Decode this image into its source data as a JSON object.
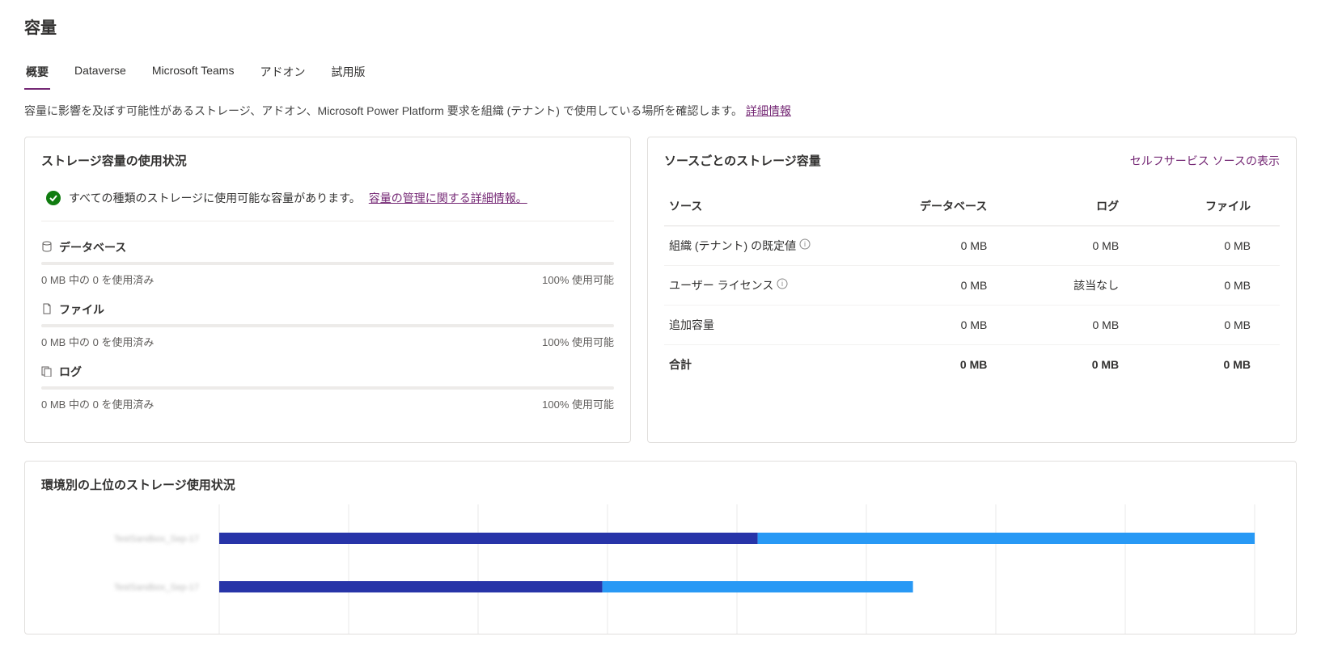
{
  "page_title": "容量",
  "tabs": [
    "概要",
    "Dataverse",
    "Microsoft Teams",
    "アドオン",
    "試用版"
  ],
  "active_tab_index": 0,
  "description_prefix": "容量に影響を及ぼす可能性があるストレージ、アドオン、Microsoft Power Platform 要求を組織 (テナント) で使用している場所を確認します。",
  "description_link": "詳細情報",
  "usage_card": {
    "title": "ストレージ容量の使用状況",
    "status_text": "すべての種類のストレージに使用可能な容量があります。",
    "status_link": "容量の管理に関する詳細情報。",
    "items": [
      {
        "icon": "database",
        "label": "データベース",
        "used": "0 MB 中の 0 を使用済み",
        "avail": "100% 使用可能"
      },
      {
        "icon": "file",
        "label": "ファイル",
        "used": "0 MB 中の 0 を使用済み",
        "avail": "100% 使用可能"
      },
      {
        "icon": "log",
        "label": "ログ",
        "used": "0 MB 中の 0 を使用済み",
        "avail": "100% 使用可能"
      }
    ]
  },
  "source_card": {
    "title": "ソースごとのストレージ容量",
    "self_service": "セルフサービス ソースの表示",
    "headers": [
      "ソース",
      "データベース",
      "ログ",
      "ファイル"
    ],
    "rows": [
      {
        "label": "組織 (テナント) の既定値",
        "info": true,
        "db": "0 MB",
        "log": "0 MB",
        "file": "0 MB"
      },
      {
        "label": "ユーザー ライセンス",
        "info": true,
        "db": "0 MB",
        "log": "該当なし",
        "file": "0 MB"
      },
      {
        "label": "追加容量",
        "info": false,
        "db": "0 MB",
        "log": "0 MB",
        "file": "0 MB"
      }
    ],
    "total": {
      "label": "合計",
      "db": "0 MB",
      "log": "0 MB",
      "file": "0 MB"
    }
  },
  "env_card": {
    "title": "環境別の上位のストレージ使用状況"
  },
  "chart_data": {
    "type": "bar",
    "orientation": "horizontal",
    "stacked": true,
    "categories": [
      "TestSandbox_Sep-17",
      "TestSandbox_Sep-17"
    ],
    "series": [
      {
        "name": "dark",
        "color": "#2734a8",
        "values": [
          52,
          37
        ]
      },
      {
        "name": "light",
        "color": "#2899f5",
        "values": [
          48,
          30
        ]
      }
    ],
    "xlim": [
      0,
      100
    ],
    "gridlines": 8
  }
}
